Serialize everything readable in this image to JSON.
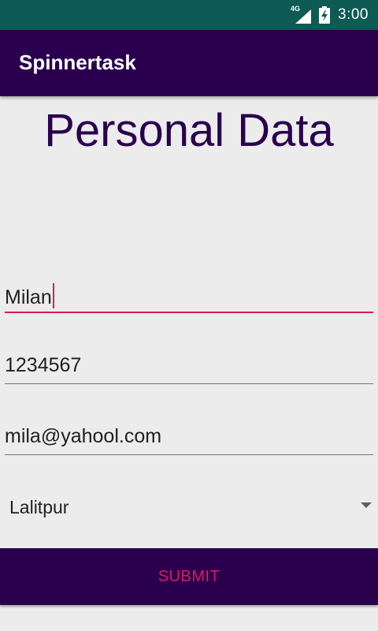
{
  "status_bar": {
    "network_label": "4G",
    "time": "3:00",
    "icons": [
      "signal-icon",
      "battery-charging-icon"
    ]
  },
  "app_bar": {
    "title": "Spinnertask"
  },
  "heading": "Personal Data",
  "form": {
    "name_value": "Milan",
    "phone_value": "1234567",
    "email_value": "mila@yahool.com",
    "city_selected": "Lalitpur"
  },
  "submit_label": "SUBMIT",
  "colors": {
    "status_bar": "#0e5a55",
    "primary": "#2a004e",
    "accent": "#d81b60",
    "background": "#ececec"
  }
}
